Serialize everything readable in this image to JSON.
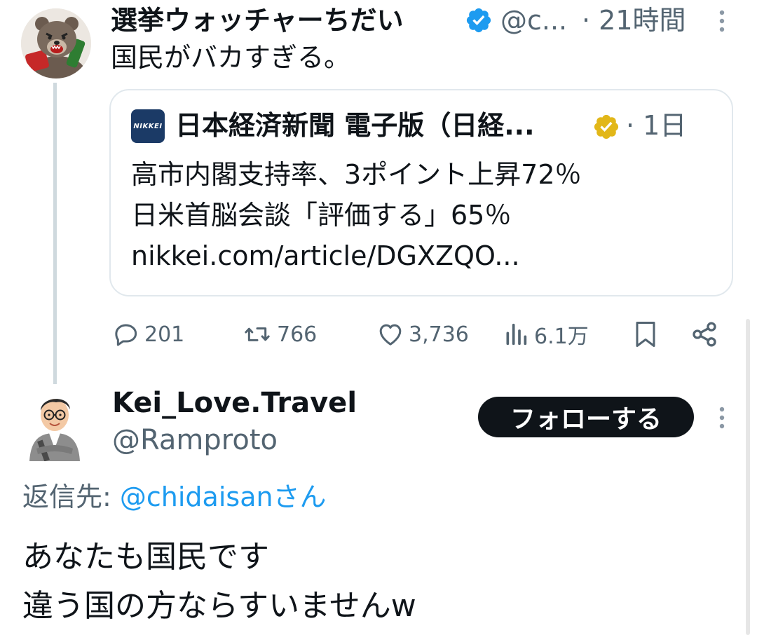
{
  "colors": {
    "accent": "#1d9bf0",
    "gold": "#e2b719",
    "muted": "#536471",
    "text": "#0f1419",
    "nikkei": "#1b3a66"
  },
  "tweet1": {
    "author_name": "選挙ウォッチャーちだい",
    "handle": "@c...",
    "time": "· 21時間",
    "text": "国民がバカすぎる。",
    "avatar_icon": "bear-avatar-icon",
    "quote": {
      "logo_text": "NIKKEI",
      "author_name": "日本経済新聞 電子版（日経...",
      "time": "· 1日",
      "lines": [
        "高市内閣支持率、3ポイント上昇72％",
        "日米首脳会談「評価する」65％",
        "nikkei.com/article/DGXZQO..."
      ]
    },
    "actions": {
      "replies": "201",
      "retweets": "766",
      "likes": "3,736",
      "views": "6.1万"
    }
  },
  "tweet2": {
    "author_name": "Kei_Love.Travel",
    "handle": "@Ramproto",
    "follow_label": "フォローする",
    "reply_prefix": "返信先: ",
    "reply_mention": "@chidaisanさん",
    "lines": [
      "あなたも国民です",
      "違う国の方ならすいませんw"
    ]
  }
}
